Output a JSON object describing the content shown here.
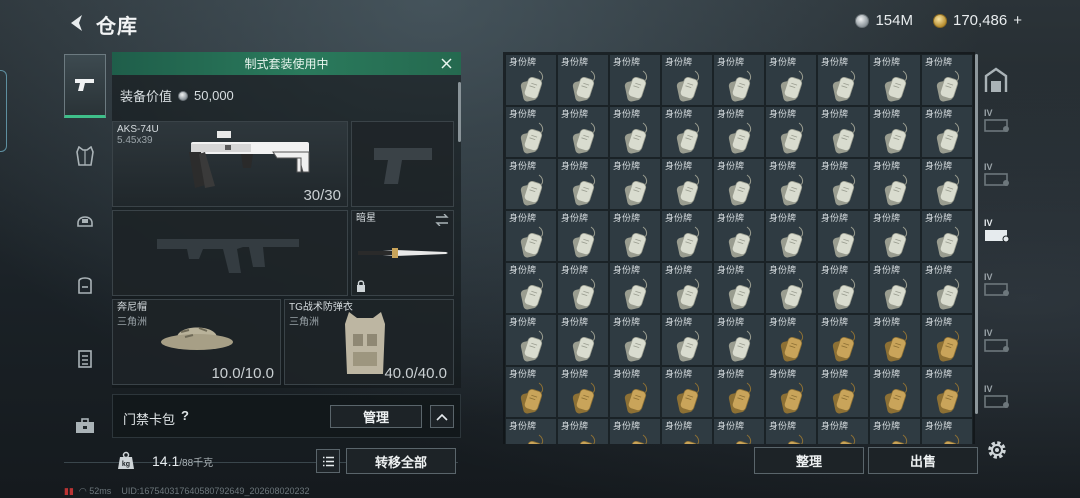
{
  "header": {
    "title": "仓库",
    "currency_silver": "154M",
    "currency_gold": "170,486",
    "currency_gold_suffix": "+"
  },
  "loadout": {
    "kit_banner": "制式套装使用中",
    "equip_value_label": "装备价值",
    "equip_value": "50,000",
    "primary_weapon": {
      "name": "AKS-74U",
      "ammo": "5.45x39",
      "count": "30/30"
    },
    "melee": {
      "name": "暗星"
    },
    "helmet": {
      "name": "奔尼帽",
      "origin": "三角洲",
      "durability": "10.0/10.0"
    },
    "armor": {
      "name": "TG战术防弹衣",
      "origin": "三角洲",
      "durability": "40.0/40.0"
    },
    "card_pack_label": "门禁卡包",
    "card_pack_help": "?",
    "manage_label": "管理",
    "weight_value": "14.1",
    "weight_capacity": "/88千克",
    "transfer_all_label": "转移全部"
  },
  "stash": {
    "item_label": "身份牌",
    "cells": [
      "silver",
      "silver",
      "silver",
      "silver",
      "silver",
      "silver",
      "silver",
      "silver",
      "silver",
      "silver",
      "silver",
      "silver",
      "silver",
      "silver",
      "silver",
      "silver",
      "silver",
      "silver",
      "silver",
      "silver",
      "silver",
      "silver",
      "silver",
      "silver",
      "silver",
      "silver",
      "silver",
      "silver",
      "silver",
      "silver",
      "silver",
      "silver",
      "silver",
      "silver",
      "silver",
      "silver",
      "silver",
      "silver",
      "silver",
      "silver",
      "silver",
      "silver",
      "silver",
      "silver",
      "silver",
      "silver",
      "silver",
      "silver",
      "silver",
      "silver",
      "gold",
      "gold",
      "gold",
      "gold",
      "gold",
      "gold",
      "gold",
      "gold",
      "gold",
      "gold",
      "gold",
      "gold",
      "gold",
      "gold",
      "gold",
      "gold",
      "gold",
      "gold",
      "gold",
      "gold",
      "gold",
      "gold"
    ],
    "sort_label": "整理",
    "sell_label": "出售",
    "tab_label": "IV"
  },
  "status": {
    "ping": "52ms",
    "uid": "UID:1675403176405807926​49_20260802​0232"
  },
  "colors": {
    "accent_green": "#2a7a5c",
    "tag_silver": "#d9dccf",
    "tag_gold": "#c9a45a"
  }
}
